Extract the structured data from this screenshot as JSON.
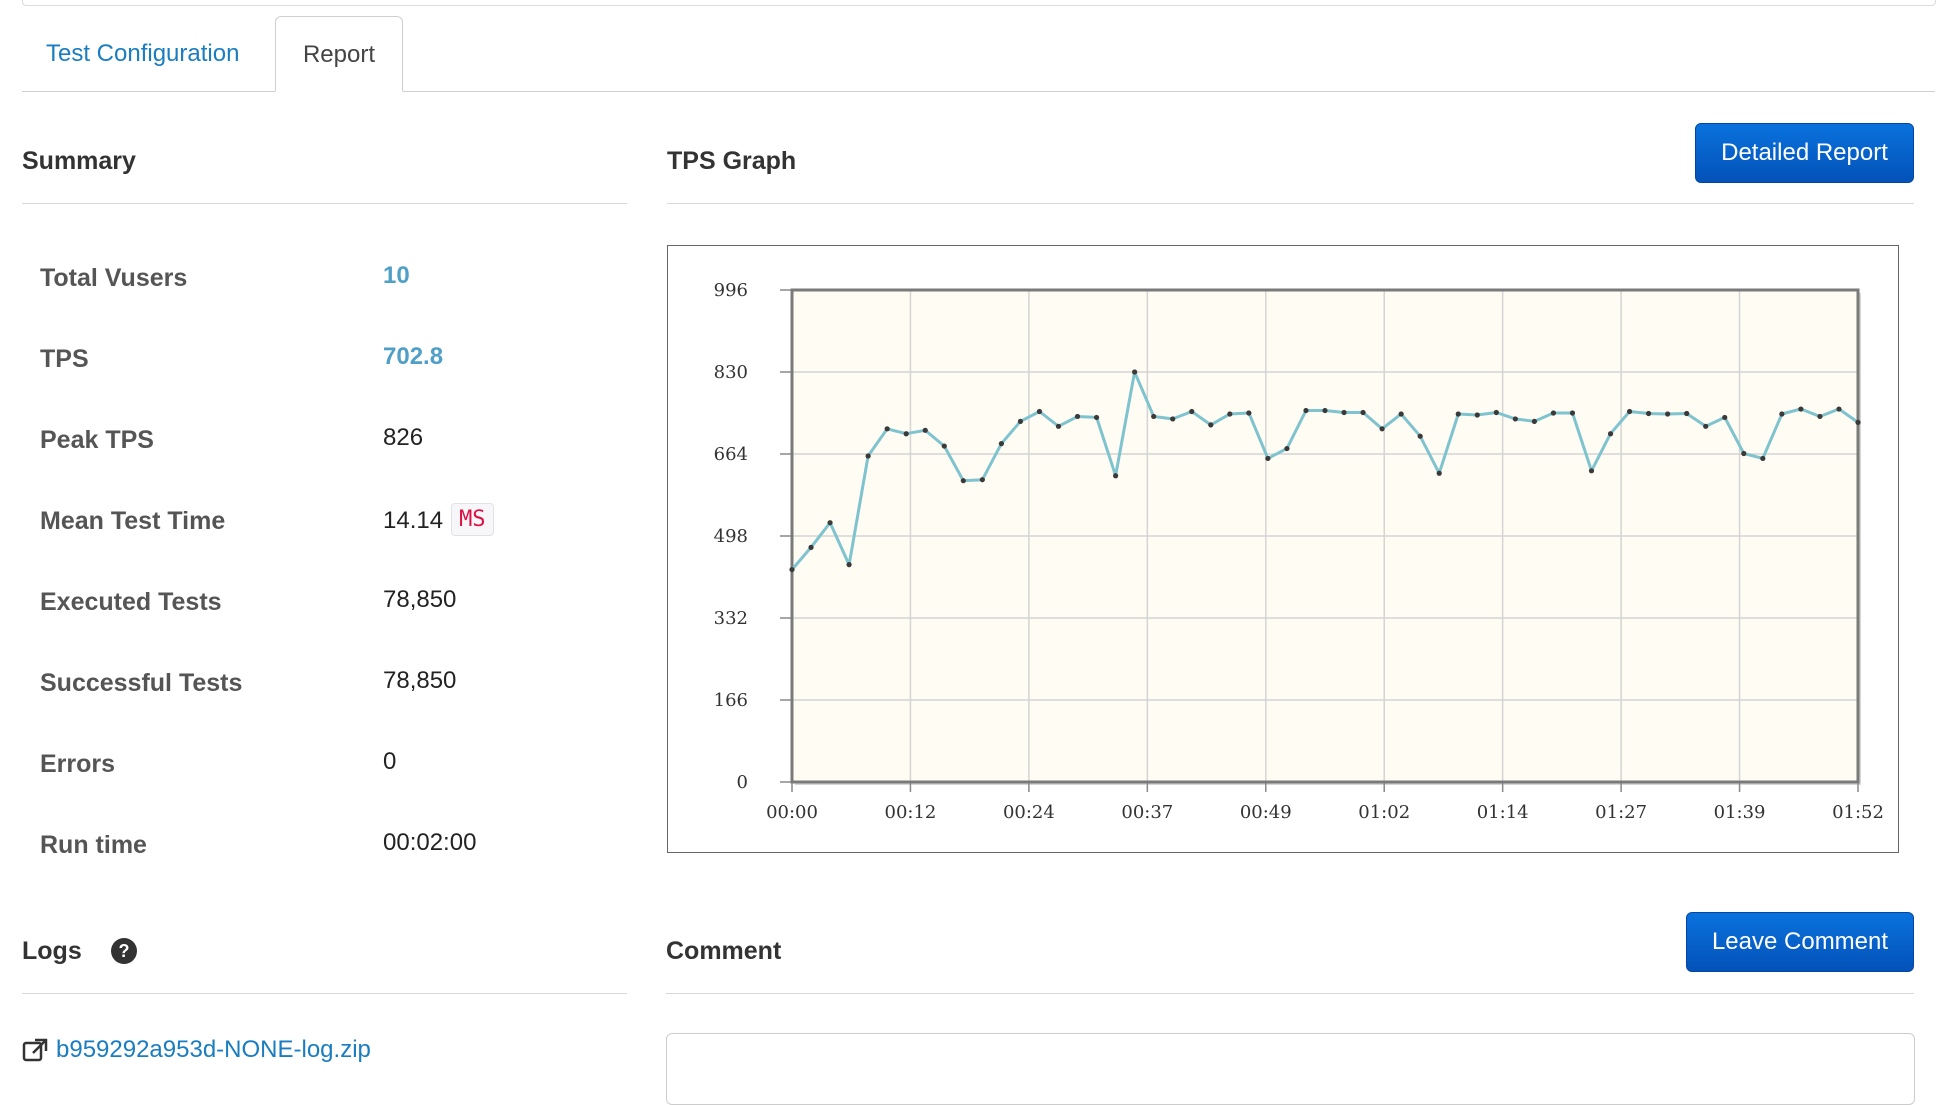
{
  "tabs": [
    {
      "label": "Test Configuration"
    },
    {
      "label": "Report"
    }
  ],
  "summary": {
    "title": "Summary",
    "rows": [
      {
        "label": "Total Vusers",
        "value": "10"
      },
      {
        "label": "TPS",
        "value": "702.8"
      },
      {
        "label": "Peak TPS",
        "value": "826"
      },
      {
        "label": "Mean Test Time",
        "value": "14.14",
        "unit": "MS"
      },
      {
        "label": "Executed Tests",
        "value": "78,850"
      },
      {
        "label": "Successful Tests",
        "value": "78,850"
      },
      {
        "label": "Errors",
        "value": "0"
      },
      {
        "label": "Run time",
        "value": "00:02:00"
      }
    ]
  },
  "graph_section": {
    "title": "TPS Graph",
    "detailed_report_label": "Detailed Report"
  },
  "logs": {
    "title": "Logs",
    "help_icon": "question-circle-icon",
    "file_name": "b959292a953d-NONE-log.zip",
    "link_icon": "external-link-icon"
  },
  "comment": {
    "title": "Comment",
    "leave_comment_label": "Leave Comment"
  },
  "colors": {
    "link": "#1a7dc2",
    "accent_value": "#4f9fc7",
    "button": "#0352b8",
    "series_line": "#7fc3cf",
    "plot_background": "#fffcf3"
  },
  "chart_data": {
    "type": "line",
    "ylim": [
      0,
      996
    ],
    "yticks": [
      "996",
      "830",
      "664",
      "498",
      "332",
      "166",
      "0"
    ],
    "xticks": [
      "00:00",
      "00:12",
      "00:24",
      "00:37",
      "00:49",
      "01:02",
      "01:14",
      "01:27",
      "01:39",
      "01:52"
    ],
    "x_seconds_range": [
      0,
      112
    ],
    "grid": true,
    "series": [
      {
        "values": [
          430,
          475,
          525,
          440,
          660,
          715,
          705,
          712,
          680,
          610,
          612,
          685,
          730,
          750,
          720,
          740,
          738,
          620,
          830,
          740,
          735,
          750,
          723,
          745,
          747,
          655,
          675,
          752,
          752,
          748,
          748,
          715,
          745,
          700,
          625,
          745,
          743,
          748,
          735,
          730,
          747,
          747,
          630,
          705,
          750,
          746,
          745,
          746,
          720,
          738,
          665,
          655,
          745,
          755,
          740,
          755,
          728
        ]
      }
    ]
  }
}
